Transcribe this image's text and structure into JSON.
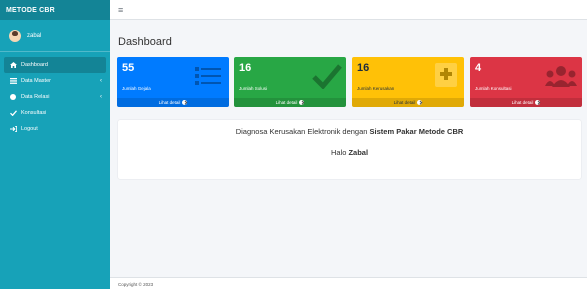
{
  "sidebar": {
    "brand": "METODE CBR",
    "user_name": "zabal",
    "items": [
      {
        "label": "Dashboard",
        "icon": "home-icon"
      },
      {
        "label": "Data Master",
        "icon": "list-icon"
      },
      {
        "label": "Data Relasi",
        "icon": "circle-icon"
      },
      {
        "label": "Konsultasi",
        "icon": "check-icon"
      },
      {
        "label": "Logout",
        "icon": "logout-icon"
      }
    ]
  },
  "header": {
    "menu_icon": "hamburger-icon"
  },
  "page": {
    "title": "Dashboard"
  },
  "boxes": [
    {
      "value": "55",
      "label": "Jumlah Gejala",
      "footer": "Lihat detail",
      "color": "#007bff",
      "icon": "list-icon"
    },
    {
      "value": "16",
      "label": "Jumlah Solusi",
      "footer": "Lihat detail",
      "color": "#28a745",
      "icon": "check-icon"
    },
    {
      "value": "16",
      "label": "Jumlah Kerusakan",
      "footer": "Lihat detail",
      "color": "#ffc107",
      "icon": "medkit-icon"
    },
    {
      "value": "4",
      "label": "Jumlah Konsultasi",
      "footer": "Lihat detail",
      "color": "#dc3545",
      "icon": "users-icon"
    }
  ],
  "card": {
    "text_prefix": "Diagnosa Kerusakan Elektronik dengan ",
    "text_bold": "Sistem Pakar Metode CBR",
    "greeting_prefix": "Halo ",
    "greeting_name": "Zabal"
  },
  "footer": {
    "copyright": "Copyright © 2023"
  }
}
